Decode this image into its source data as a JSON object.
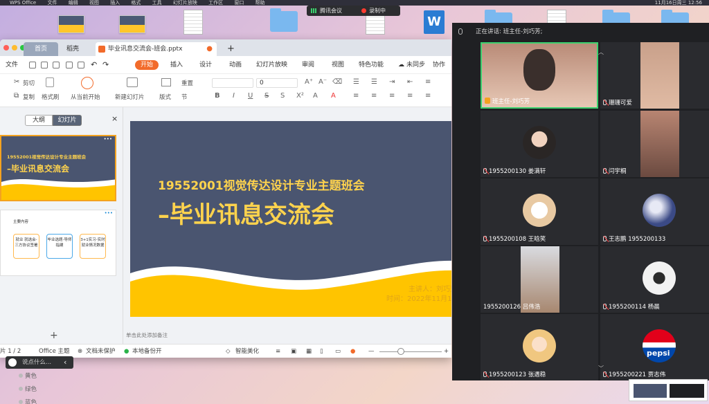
{
  "menubar": {
    "app": "WPS Office",
    "items": [
      "文件",
      "编辑",
      "视图",
      "插入",
      "格式",
      "工具",
      "幻灯片放映",
      "工作区",
      "窗口",
      "帮助"
    ],
    "time": "11月16日周三  12:56"
  },
  "meeting_pill": {
    "app": "腾讯会议",
    "recording": "录制中"
  },
  "wps": {
    "tabs": {
      "home": "首页",
      "daoke": "稻壳",
      "file": "毕业讯息交流会-班会.pptx"
    },
    "menu": {
      "file": "文件",
      "start": "开始",
      "insert": "插入",
      "design": "设计",
      "animation": "动画",
      "slideshow": "幻灯片放映",
      "review": "审阅",
      "view": "视图",
      "special": "特色功能",
      "sync": "未同步",
      "collab": "协作"
    },
    "ribbon": {
      "cut": "剪切",
      "copy": "复制",
      "format_painter": "格式刷",
      "play_from_current": "从当前开始",
      "new_slide": "新建幻灯片",
      "layout": "版式",
      "reset": "重置",
      "section": "节",
      "font_size": "0"
    },
    "panel": {
      "outline": "大纲",
      "slides": "幻灯片",
      "close": "×",
      "add": "+"
    },
    "thumb1": {
      "line1": "19552001视觉传达设计专业主题班会",
      "line2": "–毕业讯息交流会"
    },
    "thumb2": {
      "header": "主要内容",
      "b1": "就业 就选会-三方协议签署",
      "b2": "毕业选题-导师指建",
      "b3": "3+1实习-实时就业情况数据"
    },
    "slide": {
      "title1": "19552001视觉传达设计专业主题班会",
      "title2": "–毕业讯息交流会",
      "speaker": "主讲人：刘巧芳",
      "time": "时间：2022年11月16日"
    },
    "notes": "单击此处添加备注",
    "status": {
      "slide_of": "片 1 / 2",
      "theme": "Office 主题",
      "protect": "文档未保护",
      "backup": "本地备份开",
      "beautify": "智能美化"
    }
  },
  "comment": {
    "placeholder": "说点什么...",
    "colors": [
      "黄色",
      "绿色",
      "蓝色"
    ]
  },
  "meeting": {
    "speaking": "正在讲话: 班主任-刘巧芳;",
    "tiles": [
      {
        "name": "班主任-刘巧芳",
        "active": true
      },
      {
        "name": "珊珊可爱"
      },
      {
        "name": "1955200130 姜满轩"
      },
      {
        "name": "闫宇桐"
      },
      {
        "name": "1955200108 王晗笑"
      },
      {
        "name": "王志鹏 1955200133"
      },
      {
        "name": "1955200126 吕伟浩"
      },
      {
        "name": "1955200114 杨晨"
      },
      {
        "name": "1955200123 张遇稳"
      },
      {
        "name": "1955200221 贾志伟"
      }
    ],
    "pepsi": "pepsi"
  },
  "colors": {
    "accent": "#f26b2b",
    "slide_bg": "#4a5570",
    "slide_text": "#ffd34d",
    "wave": "#ffc400"
  }
}
